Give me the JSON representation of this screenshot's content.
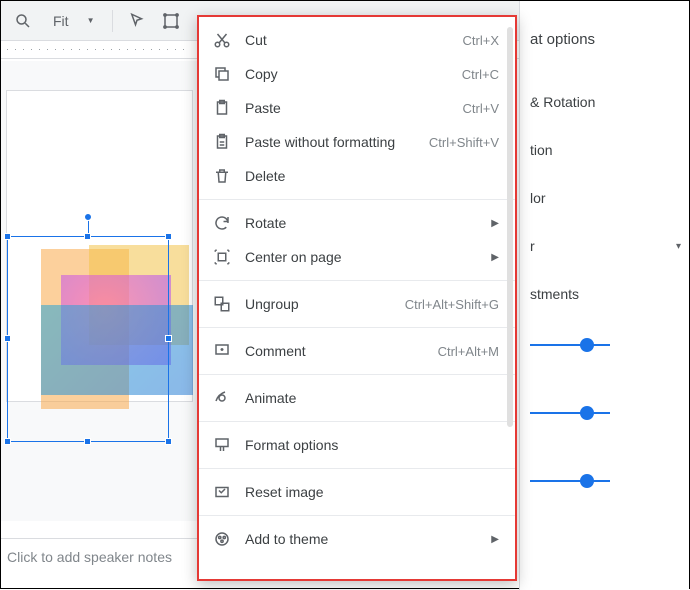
{
  "toolbar": {
    "zoom_value": "Fit"
  },
  "right_panel": {
    "title": "at options",
    "rows": [
      "& Rotation",
      "tion",
      "lor",
      "r",
      "stments"
    ]
  },
  "notes": {
    "placeholder": "Click to add speaker notes"
  },
  "menu": {
    "items": [
      {
        "label": "Cut",
        "shortcut": "Ctrl+X",
        "icon": "cut"
      },
      {
        "label": "Copy",
        "shortcut": "Ctrl+C",
        "icon": "copy"
      },
      {
        "label": "Paste",
        "shortcut": "Ctrl+V",
        "icon": "paste"
      },
      {
        "label": "Paste without formatting",
        "shortcut": "Ctrl+Shift+V",
        "icon": "paste-plain"
      },
      {
        "label": "Delete",
        "shortcut": "",
        "icon": "delete"
      },
      {
        "sep": true
      },
      {
        "label": "Rotate",
        "sub": true,
        "icon": "rotate"
      },
      {
        "label": "Center on page",
        "sub": true,
        "icon": "center"
      },
      {
        "sep": true
      },
      {
        "label": "Ungroup",
        "shortcut": "Ctrl+Alt+Shift+G",
        "icon": "ungroup"
      },
      {
        "sep": true
      },
      {
        "label": "Comment",
        "shortcut": "Ctrl+Alt+M",
        "icon": "comment"
      },
      {
        "sep": true
      },
      {
        "label": "Animate",
        "icon": "animate"
      },
      {
        "sep": true
      },
      {
        "label": "Format options",
        "icon": "format"
      },
      {
        "sep": true
      },
      {
        "label": "Reset image",
        "icon": "reset"
      },
      {
        "sep": true
      },
      {
        "label": "Add to theme",
        "sub": true,
        "icon": "theme"
      }
    ]
  }
}
